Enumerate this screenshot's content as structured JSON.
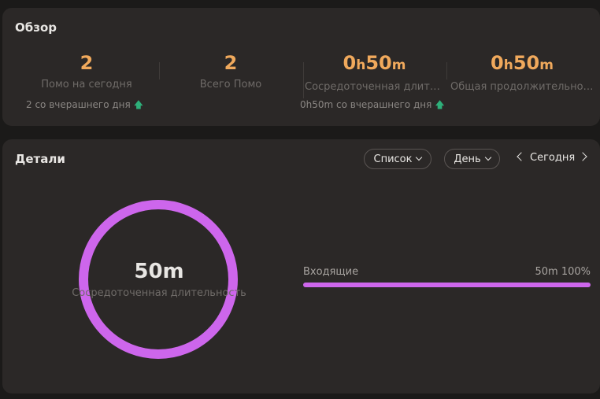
{
  "overview": {
    "title": "Обзор",
    "stats": [
      {
        "value": "2",
        "label": "Помо на сегодня",
        "delta": "2 со вчерашнего дня"
      },
      {
        "value": "2",
        "label": "Всего Помо"
      },
      {
        "value_h": "0",
        "unit_h": "h",
        "value_m": "50",
        "unit_m": "m",
        "label": "Сосредоточенная длительность",
        "delta": "0h50m со вчерашнего дня"
      },
      {
        "value_h": "0",
        "unit_h": "h",
        "value_m": "50",
        "unit_m": "m",
        "label": "Общая продолжительность"
      }
    ],
    "arrow_color": "#2eb07a"
  },
  "details": {
    "title": "Детали",
    "view_select": "Список",
    "period_select": "День",
    "date_label": "Сегодня",
    "ring": {
      "value": "50m",
      "label": "Сосредоточенная длительность",
      "color": "#cd66ec",
      "fraction": 1.0
    },
    "bars": [
      {
        "label": "Входящие",
        "duration": "50m",
        "percent_text": "100%",
        "percent": 100
      }
    ]
  },
  "colors": {
    "accent": "#f0a95c",
    "ring": "#cd66ec",
    "up": "#2eb07a"
  }
}
